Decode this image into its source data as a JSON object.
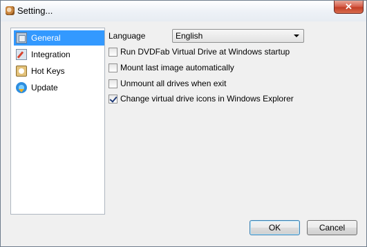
{
  "window": {
    "title": "Setting...",
    "close_label": "✕"
  },
  "nav": {
    "items": [
      {
        "label": "General",
        "icon": "settings-page-icon",
        "selected": true
      },
      {
        "label": "Integration",
        "icon": "integration-icon",
        "selected": false
      },
      {
        "label": "Hot Keys",
        "icon": "hotkeys-icon",
        "selected": false
      },
      {
        "label": "Update",
        "icon": "update-icon",
        "selected": false
      }
    ]
  },
  "general": {
    "language_label": "Language",
    "language_value": "English",
    "options": [
      {
        "label": "Run DVDFab Virtual Drive at Windows startup",
        "checked": false
      },
      {
        "label": "Mount last image automatically",
        "checked": false
      },
      {
        "label": "Unmount all drives when exit",
        "checked": false
      },
      {
        "label": "Change virtual drive icons in Windows Explorer",
        "checked": true
      }
    ]
  },
  "buttons": {
    "ok": "OK",
    "cancel": "Cancel"
  },
  "colors": {
    "selection": "#3399ff",
    "close_button": "#c33f27"
  }
}
